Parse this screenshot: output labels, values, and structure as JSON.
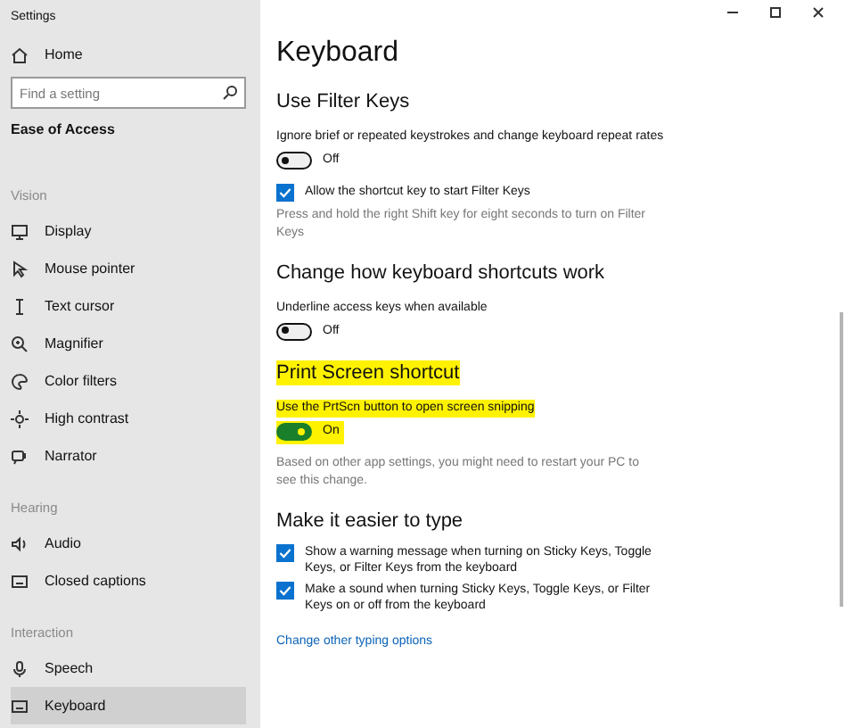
{
  "window": {
    "title": "Settings"
  },
  "sidebar": {
    "home": "Home",
    "search": {
      "placeholder": "Find a setting"
    },
    "category": "Ease of Access",
    "items": [
      {
        "kind": "header",
        "label": "Vision"
      },
      {
        "kind": "item",
        "label": "Display",
        "selected": false
      },
      {
        "kind": "item",
        "label": "Mouse pointer",
        "selected": false
      },
      {
        "kind": "item",
        "label": "Text cursor",
        "selected": false
      },
      {
        "kind": "item",
        "label": "Magnifier",
        "selected": false
      },
      {
        "kind": "item",
        "label": "Color filters",
        "selected": false
      },
      {
        "kind": "item",
        "label": "High contrast",
        "selected": false
      },
      {
        "kind": "item",
        "label": "Narrator",
        "selected": false
      },
      {
        "kind": "header",
        "label": "Hearing"
      },
      {
        "kind": "item",
        "label": "Audio",
        "selected": false
      },
      {
        "kind": "item",
        "label": "Closed captions",
        "selected": false
      },
      {
        "kind": "header",
        "label": "Interaction"
      },
      {
        "kind": "item",
        "label": "Speech",
        "selected": false
      },
      {
        "kind": "item",
        "label": "Keyboard",
        "selected": true
      }
    ]
  },
  "page_title": "Keyboard",
  "sections": [
    {
      "heading": "Use Filter Keys",
      "highlighted": false,
      "rows": [
        {
          "kind": "text",
          "text": "Ignore brief or repeated keystrokes and change keyboard repeat rates",
          "highlighted": false
        },
        {
          "kind": "toggle",
          "on": false,
          "label": "Off",
          "highlighted": false
        },
        {
          "kind": "checkbox",
          "checked": true,
          "label": "Allow the shortcut key to start Filter Keys"
        },
        {
          "kind": "note",
          "text": "Press and hold the right Shift key for eight seconds to turn on Filter Keys"
        }
      ]
    },
    {
      "heading": "Change how keyboard shortcuts work",
      "highlighted": false,
      "rows": [
        {
          "kind": "text",
          "text": "Underline access keys when available",
          "highlighted": false
        },
        {
          "kind": "toggle",
          "on": false,
          "label": "Off",
          "highlighted": false
        }
      ]
    },
    {
      "heading": "Print Screen shortcut",
      "highlighted": true,
      "rows": [
        {
          "kind": "text",
          "text": "Use the PrtScn button to open screen snipping",
          "highlighted": true
        },
        {
          "kind": "toggle",
          "on": true,
          "label": "On",
          "highlighted": true
        },
        {
          "kind": "note",
          "text": "Based on other app settings, you might need to restart your PC to see this change."
        }
      ]
    },
    {
      "heading": "Make it easier to type",
      "highlighted": false,
      "rows": [
        {
          "kind": "checkbox",
          "checked": true,
          "label": "Show a warning message when turning on Sticky Keys, Toggle Keys, or Filter Keys from the keyboard"
        },
        {
          "kind": "checkbox",
          "checked": true,
          "label": "Make a sound when turning Sticky Keys, Toggle Keys, or Filter Keys on or off from the keyboard"
        },
        {
          "kind": "link",
          "text": "Change other typing options"
        }
      ]
    }
  ]
}
